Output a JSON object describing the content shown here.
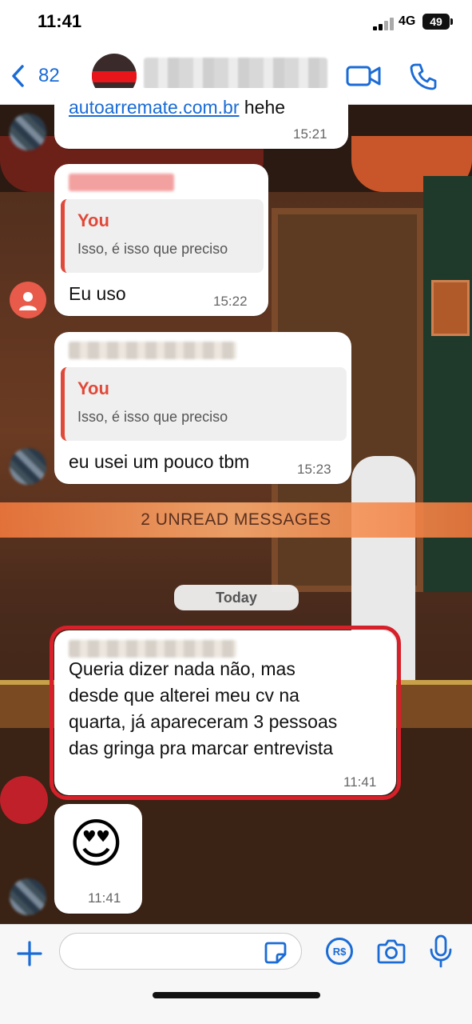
{
  "status_bar": {
    "time": "11:41",
    "network": "4G",
    "battery": "49"
  },
  "header": {
    "back_count": "82"
  },
  "messages": [
    {
      "text": "autoarremate.com.br",
      "suffix": " hehe",
      "time": "15:21"
    },
    {
      "quote_author": "You",
      "quote_text": "Isso, é isso que preciso",
      "text": "Eu uso",
      "time": "15:22"
    },
    {
      "quote_author": "You",
      "quote_text": "Isso, é isso que preciso",
      "text": "eu usei um pouco tbm",
      "time": "15:23"
    },
    {
      "text_lines": [
        "Queria dizer nada não, mas",
        "desde que alterei meu cv na",
        "quarta, já apareceram 3 pessoas",
        "das gringa pra marcar entrevista"
      ],
      "time": "11:41"
    },
    {
      "text": "😍",
      "time": "11:41"
    }
  ],
  "unread_label": "2 UNREAD MESSAGES",
  "date_divider": "Today",
  "input": {
    "placeholder": "",
    "pix_label": "R$"
  },
  "colors": {
    "accent": "#1a6bd6",
    "quote_author": "#e0493a",
    "highlight": "#d6202a",
    "unread_bar": "#f0783c"
  }
}
